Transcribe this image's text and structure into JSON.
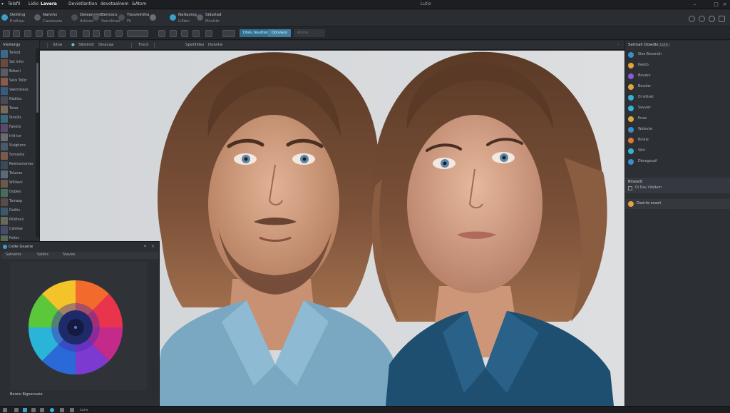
{
  "titlebar": {
    "menus": [
      "Telefil",
      "Lidio",
      "Lavera",
      "Devietlantion",
      "devotaalnem",
      "&Atom"
    ],
    "window_title": "Lutio",
    "brand_color": "#3aa0c8"
  },
  "toolbar1": {
    "groups": [
      {
        "line1": "Deliting",
        "line2": "Enilliqu"
      },
      {
        "line1": "Naivins",
        "line2": "Cassioves"
      },
      {
        "line1": "Delaanned",
        "line2": "Arlions"
      },
      {
        "line1": "Beiniscs",
        "line2": "Vurcilines"
      },
      {
        "line1": "Tisovelnitia",
        "line2": "Fil"
      },
      {
        "line1": "Natlasing",
        "line2": "Lillien"
      },
      {
        "line1": "Sidaitad",
        "line2": "Mvctile"
      }
    ]
  },
  "toolbar2": {
    "pill_active": "Dtalu Naultiad",
    "pill_secondary": "Donvaco",
    "pill_disabled": "Aisine"
  },
  "tabbar": {
    "tabs": [
      "Siloe",
      "Silldinid",
      "Sivacaa",
      "Tincli",
      "Spetllllles",
      "Delviiie"
    ]
  },
  "leftcol": {
    "header": "Vieitergy",
    "items": [
      "Taniod",
      "Set Inito",
      "Bdtorii",
      "Seiiv Tollic",
      "Vaemisiess",
      "Niallios",
      "Teoor",
      "Sinellis",
      "Fanoiis",
      "Iritt tor",
      "Sisigtions",
      "Sonuelss",
      "Reetsomanias",
      "Toluvee",
      "Wlillevii",
      "Dobles",
      "Tamasp",
      "Dolitis",
      "Pilidtovii",
      "Cahliow",
      "Foliev"
    ]
  },
  "colorpanel": {
    "title": "Celle Gsanie",
    "tabs": [
      "Sahvenis",
      "Saletis",
      "Stavies"
    ],
    "footer": "Boreio Bigoennaie"
  },
  "rightpanel": {
    "header": "Seintall Dowdles",
    "badge": "Lote",
    "items": [
      {
        "label": "Siee Bonendir",
        "color": "#3c8ec9"
      },
      {
        "label": "Keedo",
        "color": "#e8a23a"
      },
      {
        "label": "Bavasn",
        "color": "#8a5ad8"
      },
      {
        "label": "Bevoler",
        "color": "#e0a838"
      },
      {
        "label": "Di silliset",
        "color": "#3ab0d8"
      },
      {
        "label": "Savvier",
        "color": "#3ab0d8"
      },
      {
        "label": "Enaa",
        "color": "#e0a838"
      },
      {
        "label": "Woleviie",
        "color": "#3c8ec9"
      },
      {
        "label": "Bolaie",
        "color": "#e07a30"
      },
      {
        "label": "Vbit",
        "color": "#3ab0d8"
      },
      {
        "label": "Dbvegesaif",
        "color": "#3c8ec9"
      }
    ],
    "section_title": "Bitassitt",
    "section_item": "Di Dav Viledam",
    "section2_item": "Dseiriie enseit"
  },
  "statusbar": {
    "items": [
      "Lans"
    ]
  },
  "canvas": {
    "background": "#d6d9dc"
  }
}
